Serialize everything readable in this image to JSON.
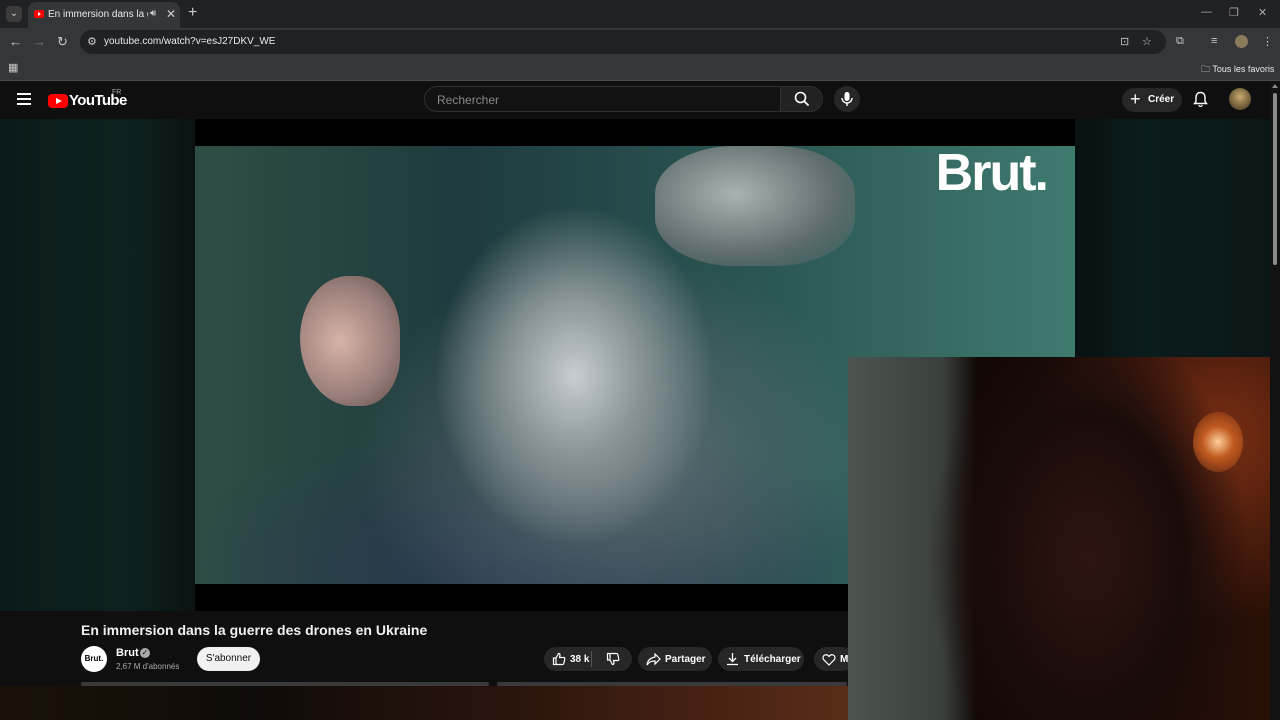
{
  "browser": {
    "tab_title": "En immersion dans la guerre des drones en Ukraine",
    "url": "youtube.com/watch?v=esJ27DKV_WE",
    "bookmarks_label": "Tous les favoris"
  },
  "youtube": {
    "logo_text": "YouTube",
    "country_code": "FR",
    "search_placeholder": "Rechercher",
    "create_label": "Créer"
  },
  "video": {
    "watermark": "Brut.",
    "title": "En immersion dans la guerre des drones en Ukraine",
    "channel_name": "Brut",
    "channel_avatar_text": "Brut.",
    "subscribers": "2,67 M d'abonnés",
    "subscribe_label": "S'abonner",
    "likes": "38 k",
    "share_label": "Partager",
    "download_label": "Télécharger",
    "more_label": "M"
  },
  "colors": {
    "brand_red": "#ff0000",
    "background": "#0f0f0f"
  }
}
